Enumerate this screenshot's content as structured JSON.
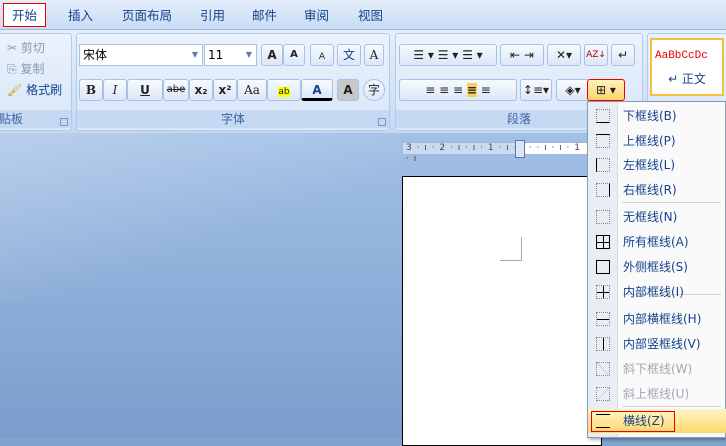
{
  "tabs": [
    "开始",
    "插入",
    "页面布局",
    "引用",
    "邮件",
    "审阅",
    "视图"
  ],
  "clipboard": {
    "cut": "剪切",
    "copy": "复制",
    "format_painter": "格式刷",
    "label": "贴板"
  },
  "font": {
    "name": "宋体",
    "size": "11",
    "label": "字体",
    "bold": "B",
    "italic": "I",
    "underline": "U",
    "strike": "abe",
    "sub": "x₂",
    "sup": "x²",
    "case": "Aa",
    "grow": "A",
    "shrink": "A",
    "clear": "A",
    "phonetic": "文",
    "border_char": "A",
    "shading_char": "A",
    "enclose": "字",
    "color": "A"
  },
  "paragraph": {
    "label": "段落"
  },
  "styles": {
    "preview": "AaBbCcDc",
    "name": "↵ 正文"
  },
  "ruler": "3 · ı · 2 · ı · ı · 1 · ı · ı ·   · ı · ı · 1 · ı",
  "menu": [
    {
      "label": "下框线(B)",
      "icon": "border-bottom"
    },
    {
      "label": "上框线(P)",
      "icon": "border-top"
    },
    {
      "label": "左框线(L)",
      "icon": "border-left"
    },
    {
      "label": "右框线(R)",
      "icon": "border-right"
    },
    {
      "label": "无框线(N)",
      "icon": "border-none"
    },
    {
      "label": "所有框线(A)",
      "icon": "border-all"
    },
    {
      "label": "外侧框线(S)",
      "icon": "border-outside"
    },
    {
      "label": "内部框线(I)",
      "icon": "border-inside"
    },
    {
      "label": "内部横框线(H)",
      "icon": "border-inside-h"
    },
    {
      "label": "内部竖框线(V)",
      "icon": "border-inside-v"
    },
    {
      "label": "斜下框线(W)",
      "icon": "diag-down",
      "disabled": true
    },
    {
      "label": "斜上框线(U)",
      "icon": "diag-up",
      "disabled": true
    },
    {
      "label": "横线(Z)",
      "icon": "horizontal-line",
      "highlighted": true
    }
  ]
}
